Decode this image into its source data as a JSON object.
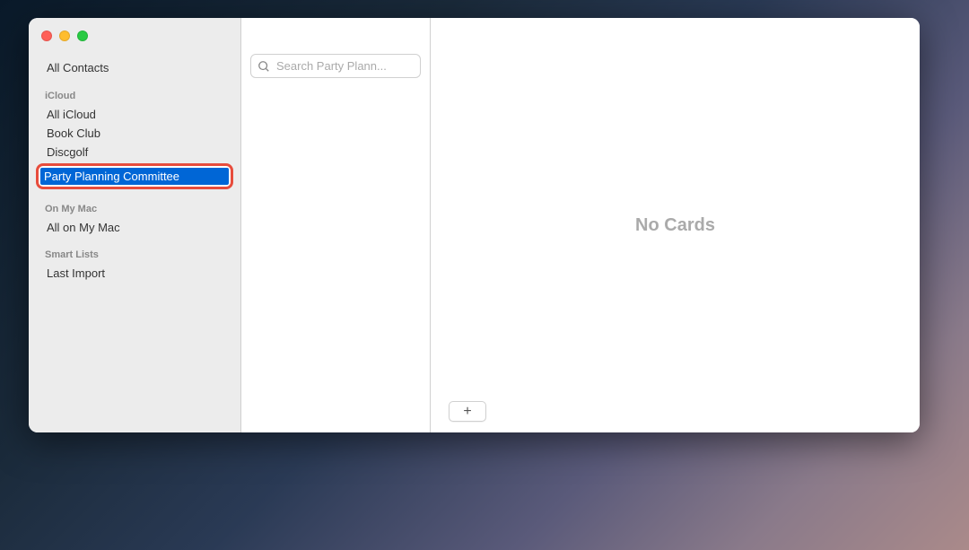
{
  "sidebar": {
    "all_contacts": "All Contacts",
    "sections": {
      "icloud": {
        "header": "iCloud",
        "items": [
          "All iCloud",
          "Book Club",
          "Discgolf"
        ],
        "editing_item": "Party Planning Committee"
      },
      "on_my_mac": {
        "header": "On My Mac",
        "items": [
          "All on My Mac"
        ]
      },
      "smart_lists": {
        "header": "Smart Lists",
        "items": [
          "Last Import"
        ]
      }
    }
  },
  "search": {
    "placeholder": "Search Party Plann..."
  },
  "detail": {
    "empty_message": "No Cards"
  }
}
